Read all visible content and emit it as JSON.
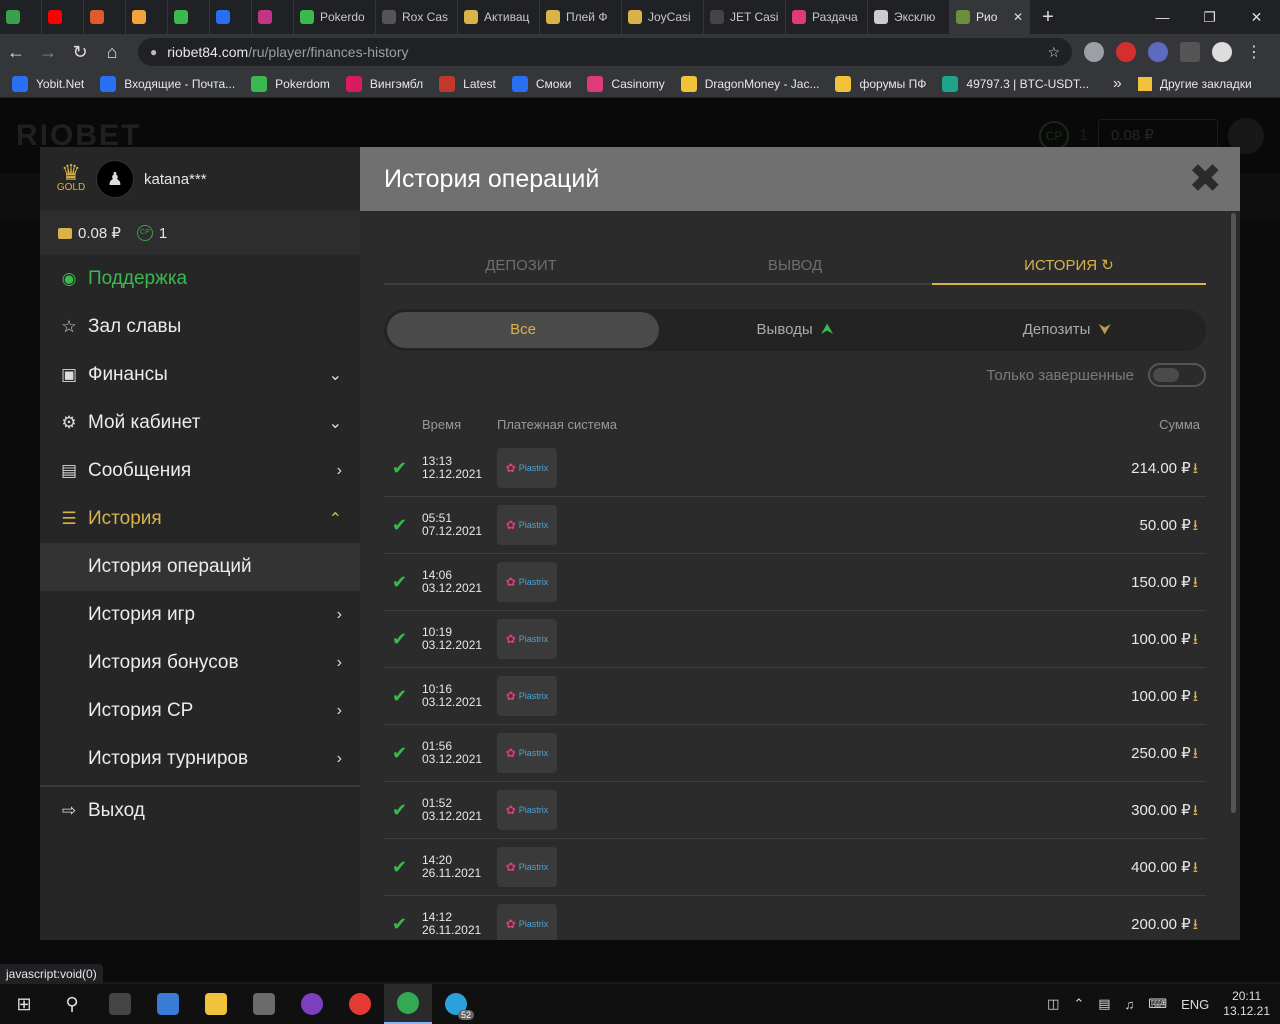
{
  "browser": {
    "tabs": [
      {
        "label": "",
        "color": "#3aa14a"
      },
      {
        "label": "",
        "color": "#ff0000"
      },
      {
        "label": "",
        "color": "#e05a2b"
      },
      {
        "label": "",
        "color": "#f2a33a"
      },
      {
        "label": "",
        "color": "#39b94e"
      },
      {
        "label": "",
        "color": "#2a6ef2"
      },
      {
        "label": "",
        "color": "#c13584"
      },
      {
        "label": "Pokerdo",
        "color": "#39b94e"
      },
      {
        "label": "Rox Cas",
        "color": "#555555"
      },
      {
        "label": "Активац",
        "color": "#d9b24a"
      },
      {
        "label": "Плей Ф",
        "color": "#d9b24a"
      },
      {
        "label": "JoyCasi",
        "color": "#d9b24a"
      },
      {
        "label": "JET Casi",
        "color": "#444444"
      },
      {
        "label": "Раздача",
        "color": "#e0397c"
      },
      {
        "label": "Эксклю",
        "color": "#cccccc"
      },
      {
        "label": "Рио",
        "color": "#6b8f3a"
      }
    ],
    "url_host": "riobet84.com",
    "url_path": "/ru/player/finances-history",
    "bookmarks": [
      {
        "label": "Yobit.Net",
        "color": "#2a6ef2"
      },
      {
        "label": "Входящие - Почта...",
        "color": "#2a6ef2"
      },
      {
        "label": "Pokerdom",
        "color": "#39b94e"
      },
      {
        "label": "Вингэмбл",
        "color": "#d81b60"
      },
      {
        "label": "Latest",
        "color": "#c0392b"
      },
      {
        "label": "Смоки",
        "color": "#2a6ef2"
      },
      {
        "label": "Casinomy",
        "color": "#e0397c"
      },
      {
        "label": "DragonMoney - Jac...",
        "color": "#f2c23a"
      },
      {
        "label": "форумы ПФ",
        "color": "#f2c23a"
      },
      {
        "label": "49797.3 | BTC-USDT...",
        "color": "#1fa38a"
      }
    ],
    "bookmarks_more": "»",
    "other_bookmarks": "Другие закладки",
    "status_url": "javascript:void(0)"
  },
  "site": {
    "logo": "RIOBET",
    "cp_count": "1",
    "balance": "0.08 ₽"
  },
  "sidebar": {
    "rank": "GOLD",
    "username": "katana***",
    "balance": "0.08 ₽",
    "cp_label": "CP",
    "cp_count": "1",
    "items": {
      "support": "Поддержка",
      "hall_of_fame": "Зал славы",
      "finances": "Финансы",
      "cabinet": "Мой кабинет",
      "messages": "Сообщения",
      "history": "История",
      "operations_history": "История операций",
      "games_history": "История игр",
      "bonus_history": "История бонусов",
      "cp_history": "История CP",
      "tournament_history": "История турниров",
      "logout": "Выход"
    }
  },
  "panel": {
    "title": "История операций",
    "tabs": {
      "deposit": "ДЕПОЗИТ",
      "withdraw": "ВЫВОД",
      "history": "ИСТОРИЯ"
    },
    "segments": {
      "all": "Все",
      "withdrawals": "Выводы",
      "deposits": "Депозиты"
    },
    "filter_label": "Только завершенные",
    "columns": {
      "time": "Время",
      "payment_system": "Платежная система",
      "amount": "Сумма"
    },
    "payment_system_name": "Piastrix",
    "rows": [
      {
        "time": "13:13",
        "date": "12.12.2021",
        "amount": "214.00 ₽"
      },
      {
        "time": "05:51",
        "date": "07.12.2021",
        "amount": "50.00 ₽"
      },
      {
        "time": "14:06",
        "date": "03.12.2021",
        "amount": "150.00 ₽"
      },
      {
        "time": "10:19",
        "date": "03.12.2021",
        "amount": "100.00 ₽"
      },
      {
        "time": "10:16",
        "date": "03.12.2021",
        "amount": "100.00 ₽"
      },
      {
        "time": "01:56",
        "date": "03.12.2021",
        "amount": "250.00 ₽"
      },
      {
        "time": "01:52",
        "date": "03.12.2021",
        "amount": "300.00 ₽"
      },
      {
        "time": "14:20",
        "date": "26.11.2021",
        "amount": "400.00 ₽"
      },
      {
        "time": "14:12",
        "date": "26.11.2021",
        "amount": "200.00 ₽"
      }
    ]
  },
  "taskbar": {
    "badge": "52",
    "lang": "ENG",
    "time": "20:11",
    "date": "13.12.21"
  }
}
